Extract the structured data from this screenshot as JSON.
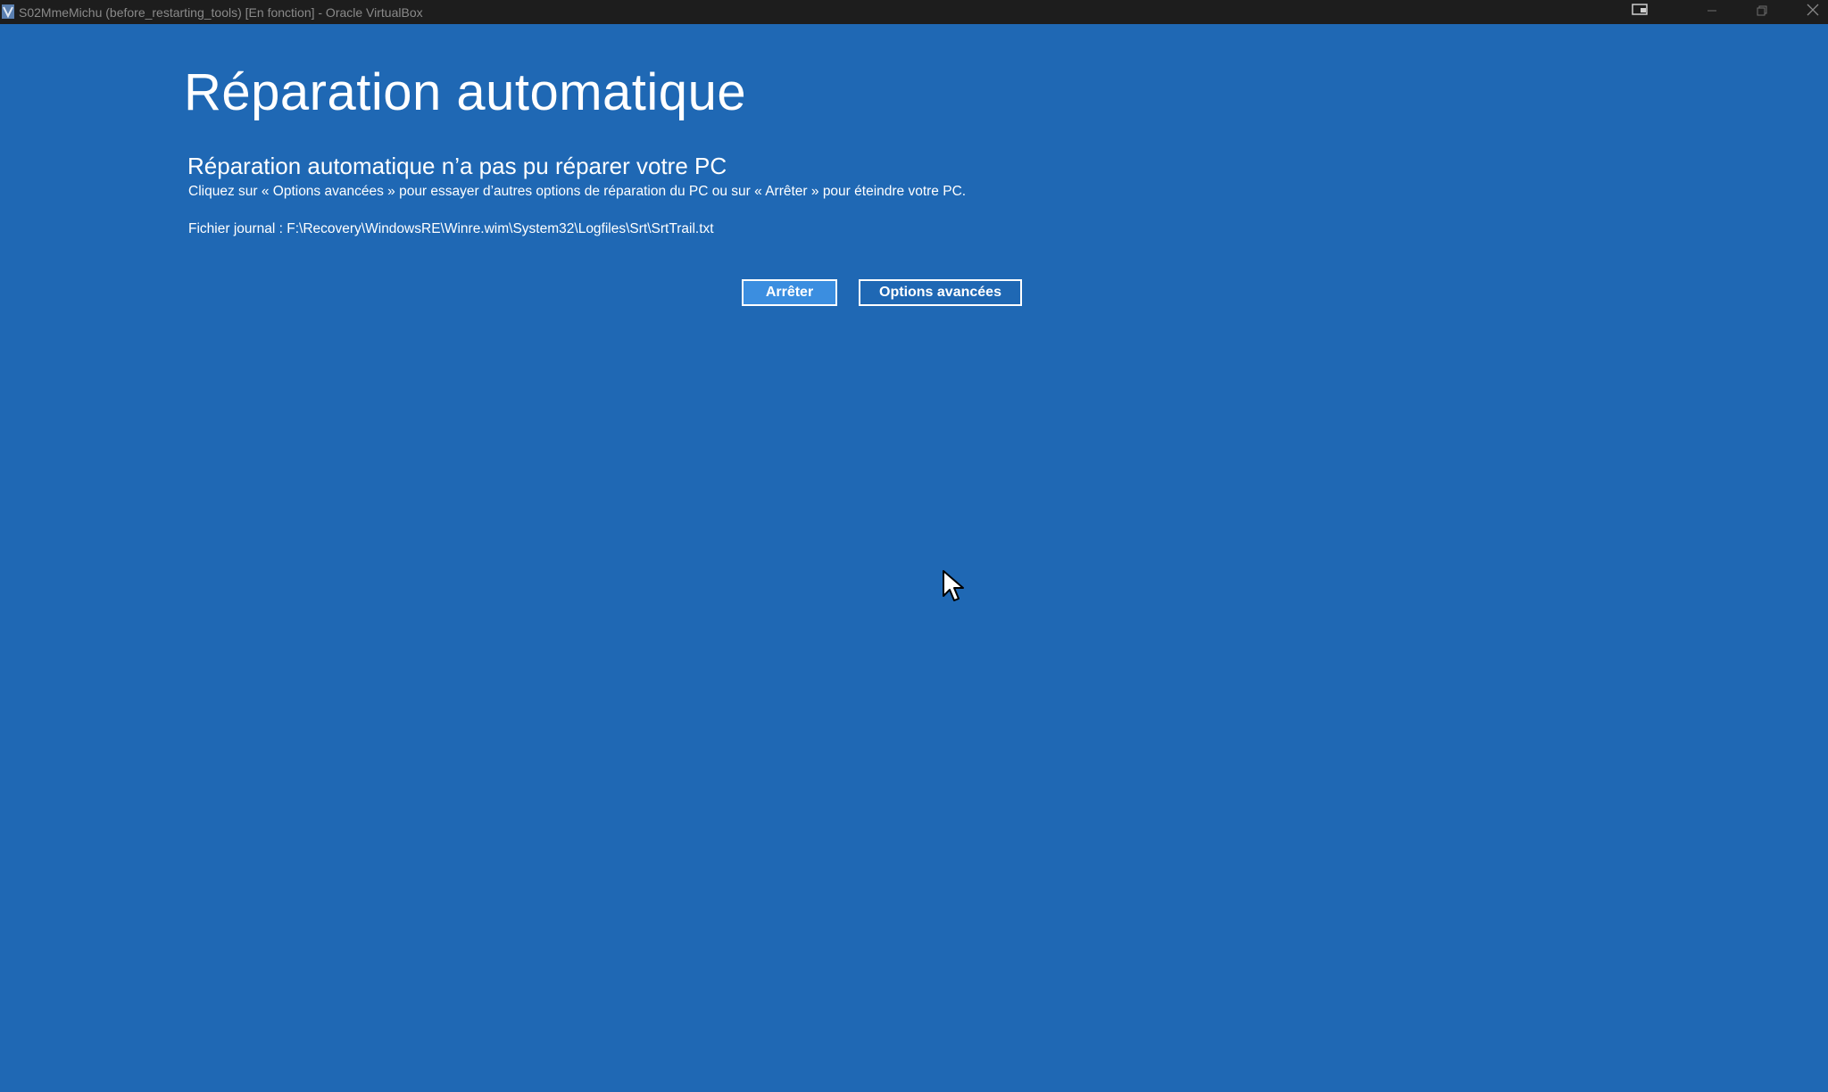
{
  "window": {
    "title": "S02MmeMichu (before_restarting_tools) [En fonction] - Oracle VirtualBox",
    "icons": [
      "virtualbox-icon",
      "display-icon",
      "minimize-icon",
      "restore-icon",
      "close-icon"
    ]
  },
  "screen": {
    "title": "Réparation automatique",
    "subtitle": "Réparation automatique n’a pas pu réparer votre PC",
    "description": "Cliquez sur « Options avancées » pour essayer d’autres options de réparation du PC ou sur « Arrêter » pour éteindre votre PC.",
    "log_file": "Fichier journal : F:\\Recovery\\WindowsRE\\Winre.wim\\System32\\Logfiles\\Srt\\SrtTrail.txt",
    "buttons": {
      "shutdown": "Arrêter",
      "advanced": "Options avancées"
    }
  },
  "colors": {
    "background": "#1f68b4",
    "titlebar": "#1d1d1d",
    "focused_button": "#3b8ee0"
  }
}
